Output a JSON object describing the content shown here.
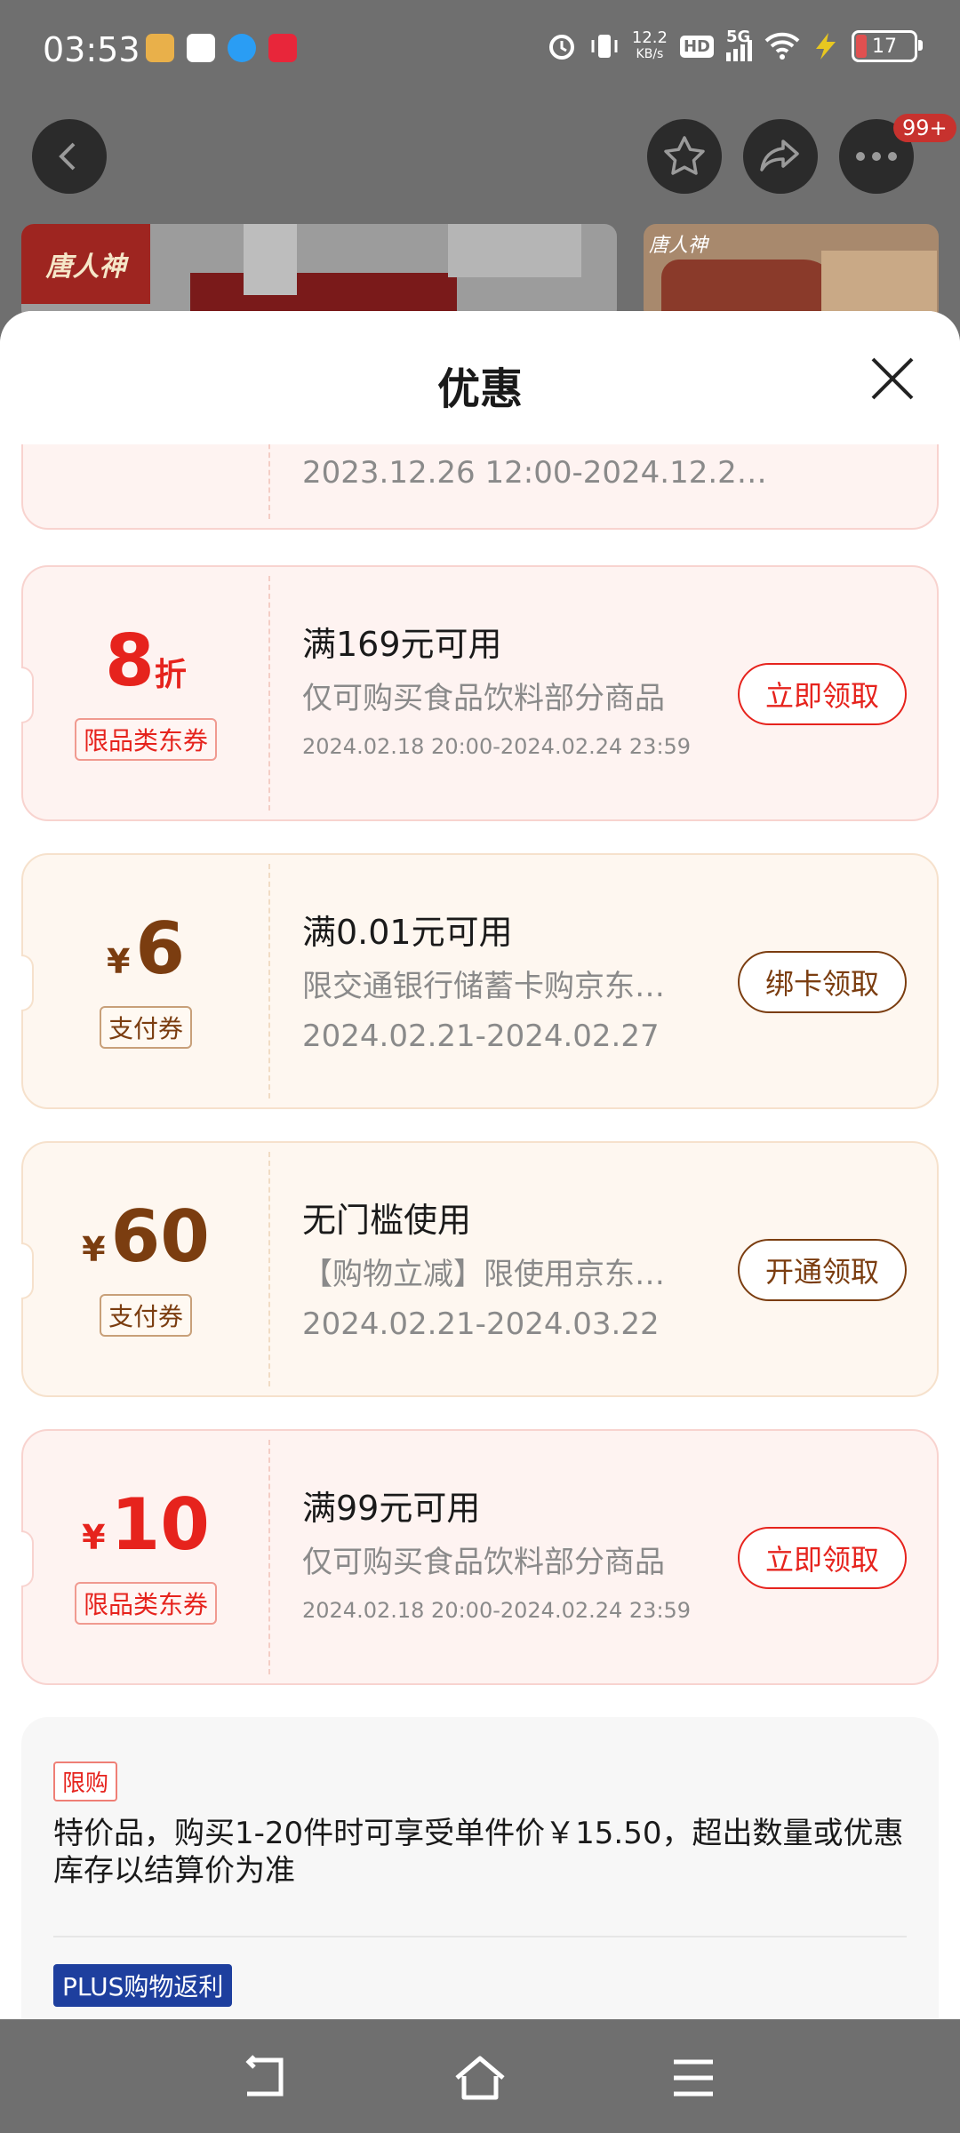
{
  "status_bar": {
    "time": "03:53",
    "network_speed_top": "12.2",
    "network_speed_bottom": "KB/s",
    "hd": "HD",
    "signal": "5G",
    "battery": "17"
  },
  "top_nav": {
    "more_badge": "99+",
    "brand_text": "唐人神"
  },
  "sheet": {
    "title": "优惠",
    "partial_coupon_date": "2023.12.26 12:00-2024.12.2…"
  },
  "coupons": [
    {
      "amount": "8",
      "unit": "折",
      "tag": "限品类东券",
      "title": "满169元可用",
      "desc": "仅可购买食品饮料部分商品",
      "date": "2024.02.18 20:00-2024.02.24 23:59",
      "button": "立即领取"
    },
    {
      "yen": "¥",
      "amount": "6",
      "tag": "支付券",
      "title": "满0.01元可用",
      "desc": "限交通银行储蓄卡购京东…",
      "date": "2024.02.21-2024.02.27",
      "button": "绑卡领取"
    },
    {
      "yen": "¥",
      "amount": "60",
      "tag": "支付券",
      "title": "无门槛使用",
      "desc": "【购物立减】限使用京东…",
      "date": "2024.02.21-2024.03.22",
      "button": "开通领取"
    },
    {
      "yen": "¥",
      "amount": "10",
      "tag": "限品类东券",
      "title": "满99元可用",
      "desc": "仅可购买食品饮料部分商品",
      "date": "2024.02.18 20:00-2024.02.24 23:59",
      "button": "立即领取"
    }
  ],
  "info": {
    "limit_tag": "限购",
    "limit_text": "特价品，购买1-20件时可享受单件价￥15.50，超出数量或优惠库存以结算价为准",
    "plus_tag": "PLUS购物返利"
  }
}
